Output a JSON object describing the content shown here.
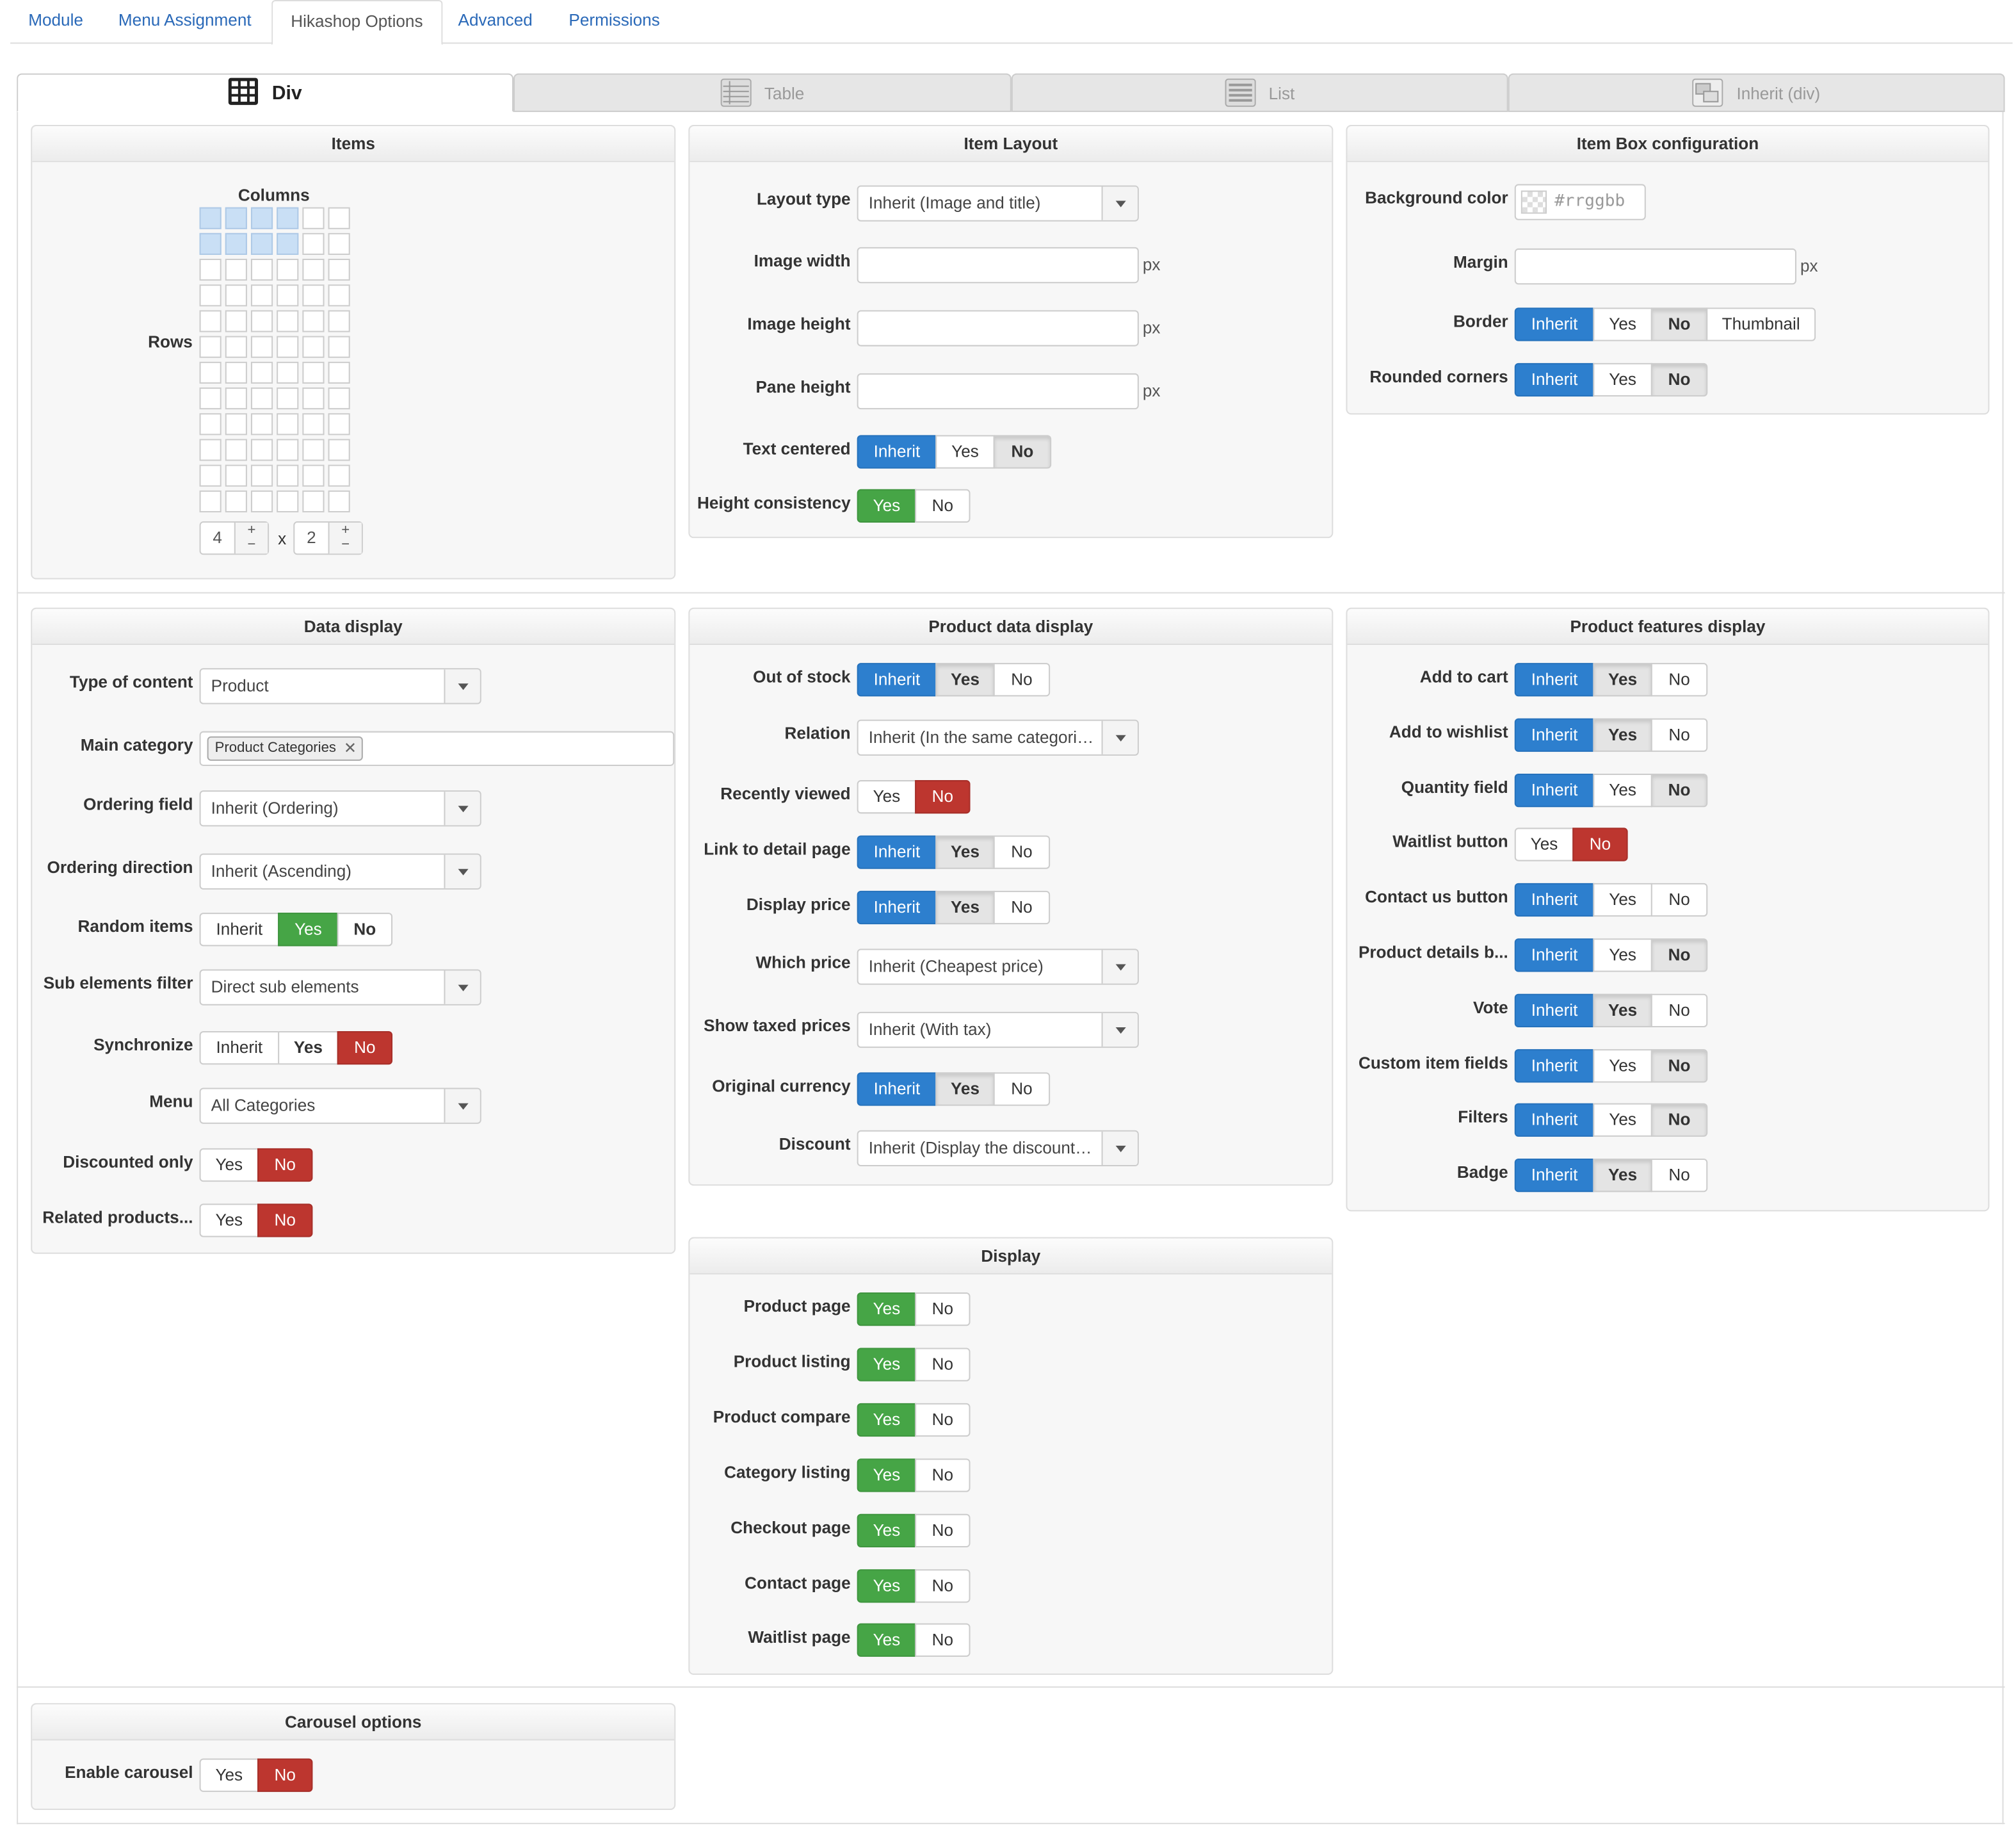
{
  "nav_tabs": [
    "Module",
    "Menu Assignment",
    "Hikashop Options",
    "Advanced",
    "Permissions"
  ],
  "active_nav_tab": "Hikashop Options",
  "layout_tabs": [
    {
      "label": "Div",
      "icon": "div-grid-icon",
      "active": true
    },
    {
      "label": "Table",
      "icon": "table-icon",
      "active": false
    },
    {
      "label": "List",
      "icon": "list-icon",
      "active": false
    },
    {
      "label": "Inherit (div)",
      "icon": "inherit-icon",
      "active": false
    }
  ],
  "items_panel": {
    "title": "Items",
    "columns_label": "Columns",
    "rows_label": "Rows",
    "grid_columns": 6,
    "grid_rows": 12,
    "columns_value": "4",
    "rows_value": "2",
    "times": "x",
    "plus": "+",
    "minus": "−"
  },
  "item_layout": {
    "title": "Item Layout",
    "layout_type": {
      "label": "Layout type",
      "value": "Inherit (Image and title)"
    },
    "image_width": {
      "label": "Image width",
      "unit": "px"
    },
    "image_height": {
      "label": "Image height",
      "unit": "px"
    },
    "pane_height": {
      "label": "Pane height",
      "unit": "px"
    },
    "text_centered": {
      "label": "Text centered",
      "options": [
        "Inherit",
        "Yes",
        "No"
      ]
    },
    "height_consistency": {
      "label": "Height consistency",
      "options": [
        "Yes",
        "No"
      ]
    }
  },
  "item_box": {
    "title": "Item Box configuration",
    "background_color": {
      "label": "Background color",
      "placeholder": "#rrggbb"
    },
    "margin": {
      "label": "Margin",
      "unit": "px"
    },
    "border": {
      "label": "Border",
      "options": [
        "Inherit",
        "Yes",
        "No",
        "Thumbnail"
      ]
    },
    "rounded_corners": {
      "label": "Rounded corners",
      "options": [
        "Inherit",
        "Yes",
        "No"
      ]
    }
  },
  "data_display": {
    "title": "Data display",
    "type_of_content": {
      "label": "Type of content",
      "value": "Product"
    },
    "main_category": {
      "label": "Main category",
      "tag": "Product Categories"
    },
    "ordering_field": {
      "label": "Ordering field",
      "value": "Inherit (Ordering)"
    },
    "ordering_direction": {
      "label": "Ordering direction",
      "value": "Inherit (Ascending)"
    },
    "random_items": {
      "label": "Random items",
      "options": [
        "Inherit",
        "Yes",
        "No"
      ]
    },
    "sub_elements_filter": {
      "label": "Sub elements filter",
      "value": "Direct sub elements"
    },
    "synchronize": {
      "label": "Synchronize",
      "options": [
        "Inherit",
        "Yes",
        "No"
      ]
    },
    "menu": {
      "label": "Menu",
      "value": "All Categories"
    },
    "discounted_only": {
      "label": "Discounted only",
      "options": [
        "Yes",
        "No"
      ]
    },
    "related_products": {
      "label": "Related products...",
      "options": [
        "Yes",
        "No"
      ]
    }
  },
  "product_data": {
    "title": "Product data display",
    "out_of_stock": {
      "label": "Out of stock",
      "options": [
        "Inherit",
        "Yes",
        "No"
      ]
    },
    "relation": {
      "label": "Relation",
      "value": "Inherit (In the same categories)"
    },
    "recently_viewed": {
      "label": "Recently viewed",
      "options": [
        "Yes",
        "No"
      ]
    },
    "link_to_detail": {
      "label": "Link to detail page",
      "options": [
        "Inherit",
        "Yes",
        "No"
      ]
    },
    "display_price": {
      "label": "Display price",
      "options": [
        "Inherit",
        "Yes",
        "No"
      ]
    },
    "which_price": {
      "label": "Which price",
      "value": "Inherit (Cheapest price)"
    },
    "show_taxed_prices": {
      "label": "Show taxed prices",
      "value": "Inherit (With tax)"
    },
    "original_currency": {
      "label": "Original currency",
      "options": [
        "Inherit",
        "Yes",
        "No"
      ]
    },
    "discount": {
      "label": "Discount",
      "value": "Inherit (Display the discount amount)"
    }
  },
  "product_features": {
    "title": "Product features display",
    "add_to_cart": {
      "label": "Add to cart",
      "options": [
        "Inherit",
        "Yes",
        "No"
      ]
    },
    "add_to_wishlist": {
      "label": "Add to wishlist",
      "options": [
        "Inherit",
        "Yes",
        "No"
      ]
    },
    "quantity_field": {
      "label": "Quantity field",
      "options": [
        "Inherit",
        "Yes",
        "No"
      ]
    },
    "waitlist_button": {
      "label": "Waitlist button",
      "options": [
        "Yes",
        "No"
      ]
    },
    "contact_us_button": {
      "label": "Contact us button",
      "options": [
        "Inherit",
        "Yes",
        "No"
      ]
    },
    "product_details": {
      "label": "Product details b...",
      "options": [
        "Inherit",
        "Yes",
        "No"
      ]
    },
    "vote": {
      "label": "Vote",
      "options": [
        "Inherit",
        "Yes",
        "No"
      ]
    },
    "custom_item_fields": {
      "label": "Custom item fields",
      "options": [
        "Inherit",
        "Yes",
        "No"
      ]
    },
    "filters": {
      "label": "Filters",
      "options": [
        "Inherit",
        "Yes",
        "No"
      ]
    },
    "badge": {
      "label": "Badge",
      "options": [
        "Inherit",
        "Yes",
        "No"
      ]
    }
  },
  "display": {
    "title": "Display",
    "product_page": {
      "label": "Product page",
      "options": [
        "Yes",
        "No"
      ]
    },
    "product_listing": {
      "label": "Product listing",
      "options": [
        "Yes",
        "No"
      ]
    },
    "product_compare": {
      "label": "Product compare",
      "options": [
        "Yes",
        "No"
      ]
    },
    "category_listing": {
      "label": "Category listing",
      "options": [
        "Yes",
        "No"
      ]
    },
    "checkout_page": {
      "label": "Checkout page",
      "options": [
        "Yes",
        "No"
      ]
    },
    "contact_page": {
      "label": "Contact page",
      "options": [
        "Yes",
        "No"
      ]
    },
    "waitlist_page": {
      "label": "Waitlist page",
      "options": [
        "Yes",
        "No"
      ]
    }
  },
  "carousel": {
    "title": "Carousel options",
    "enable_carousel": {
      "label": "Enable carousel",
      "options": [
        "Yes",
        "No"
      ]
    }
  },
  "colors": {
    "link": "#2a69b8",
    "inherit_blue": "#2d7fce",
    "yes_green": "#46a546",
    "no_red": "#bd362f"
  }
}
